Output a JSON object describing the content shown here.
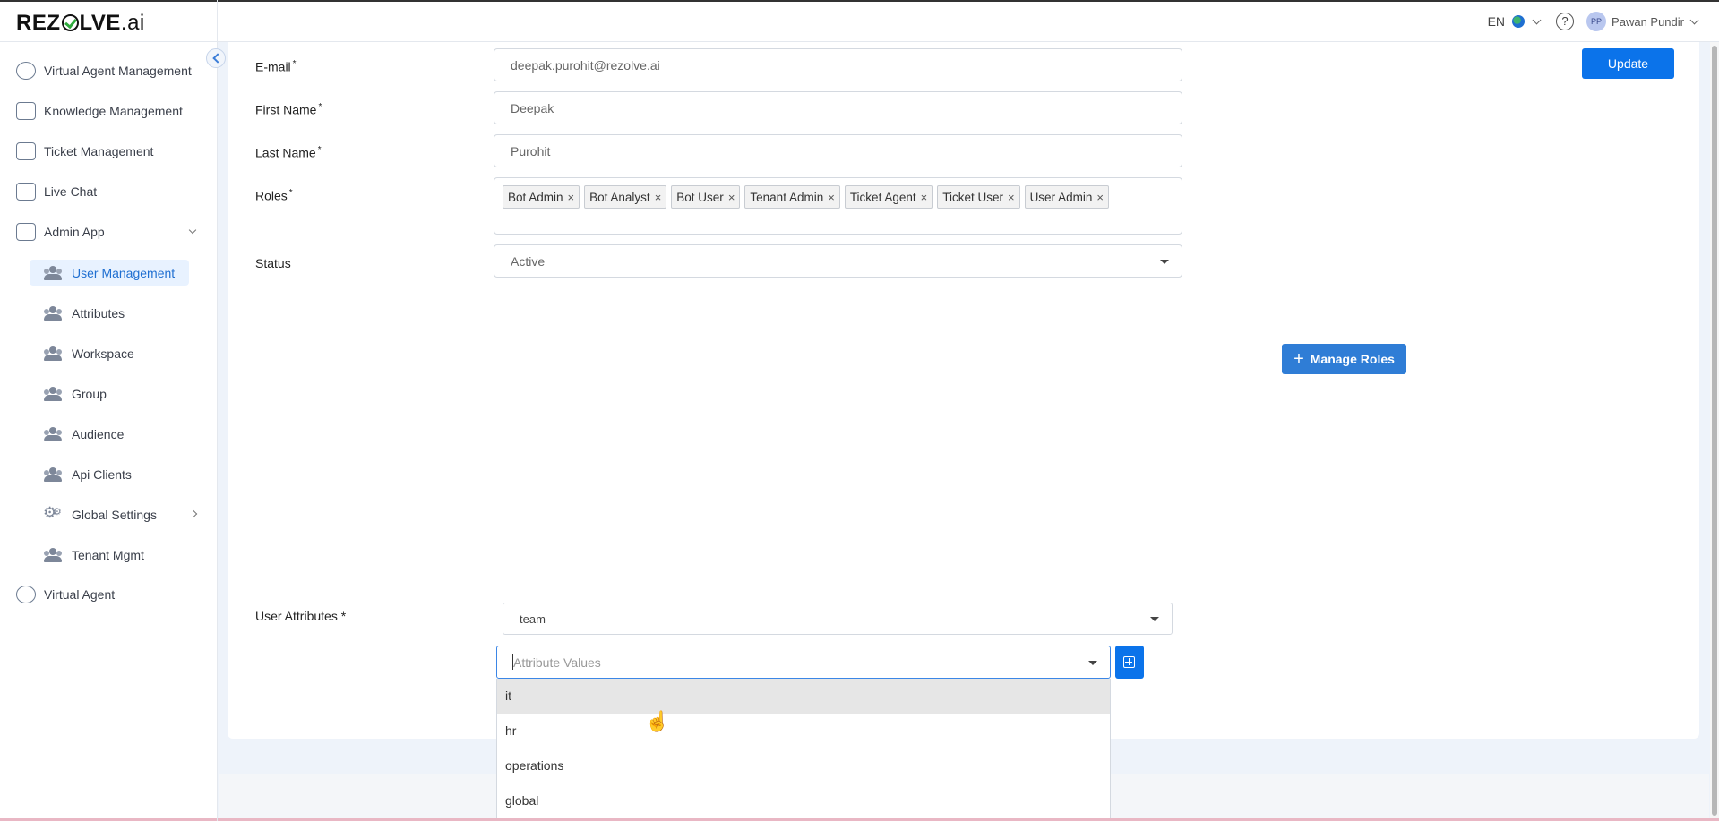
{
  "header": {
    "logo_text_left": "REZ",
    "logo_text_right": "LVE",
    "logo_suffix": ".ai",
    "language": "EN",
    "help_symbol": "?",
    "user_initials": "PP",
    "user_name": "Pawan Pundir"
  },
  "sidebar": {
    "items": [
      {
        "label": "Virtual Agent Management",
        "icon": "users-outline-icon"
      },
      {
        "label": "Knowledge Management",
        "icon": "book-icon"
      },
      {
        "label": "Ticket Management",
        "icon": "ticket-icon"
      },
      {
        "label": "Live Chat",
        "icon": "chat-icon"
      },
      {
        "label": "Admin App",
        "icon": "sliders-icon"
      },
      {
        "label": "Virtual Agent",
        "icon": "headset-icon"
      }
    ],
    "admin_sub_items": [
      {
        "label": "User Management",
        "active": true
      },
      {
        "label": "Attributes"
      },
      {
        "label": "Workspace"
      },
      {
        "label": "Group"
      },
      {
        "label": "Audience"
      },
      {
        "label": "Api Clients"
      },
      {
        "label": "Global Settings"
      },
      {
        "label": "Tenant Mgmt"
      }
    ]
  },
  "form": {
    "email_label": "E-mail",
    "email_value": "deepak.purohit@rezolve.ai",
    "first_name_label": "First Name",
    "first_name_value": "Deepak",
    "last_name_label": "Last Name",
    "last_name_value": "Purohit",
    "roles_label": "Roles",
    "roles": [
      "Bot Admin",
      "Bot Analyst",
      "Bot User",
      "Tenant Admin",
      "Ticket Agent",
      "Ticket User",
      "User Admin"
    ],
    "status_label": "Status",
    "status_value": "Active",
    "required_mark": "*",
    "update_button": "Update",
    "manage_roles_button": "Manage Roles",
    "user_attributes_label": "User Attributes *",
    "attribute_select_value": "team",
    "attribute_values_placeholder": "Attribute Values",
    "attribute_options": [
      "it",
      "hr",
      "operations",
      "global"
    ]
  },
  "colors": {
    "primary": "#0b73ea",
    "active_nav_bg": "#e8f2ff",
    "active_nav_text": "#1f6fd1"
  }
}
